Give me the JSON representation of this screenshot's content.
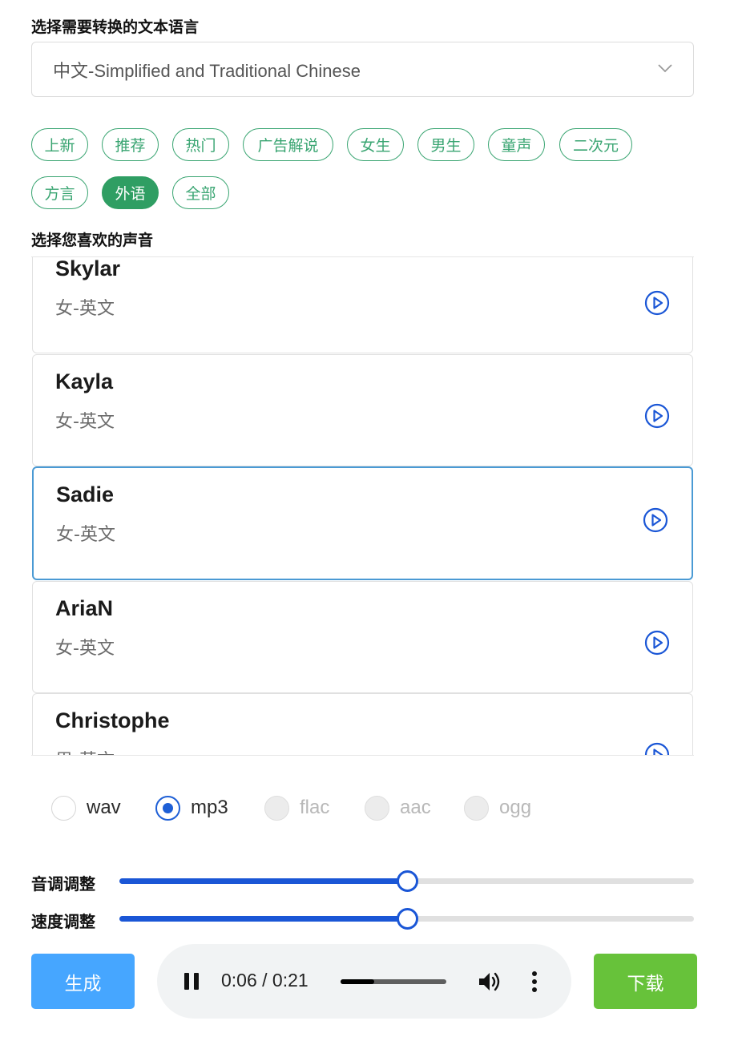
{
  "language_section": {
    "label": "选择需要转换的文本语言",
    "selected_value": "中文-Simplified and Traditional Chinese"
  },
  "category_tags": [
    {
      "label": "上新",
      "active": false
    },
    {
      "label": "推荐",
      "active": false
    },
    {
      "label": "热门",
      "active": false
    },
    {
      "label": "广告解说",
      "active": false
    },
    {
      "label": "女生",
      "active": false
    },
    {
      "label": "男生",
      "active": false
    },
    {
      "label": "童声",
      "active": false
    },
    {
      "label": "二次元",
      "active": false
    },
    {
      "label": "方言",
      "active": false
    },
    {
      "label": "外语",
      "active": true
    },
    {
      "label": "全部",
      "active": false
    }
  ],
  "voice_section": {
    "label": "选择您喜欢的声音",
    "voices": [
      {
        "name": "Skylar",
        "desc": "女-英文",
        "selected": false
      },
      {
        "name": "Kayla",
        "desc": "女-英文",
        "selected": false
      },
      {
        "name": "Sadie",
        "desc": "女-英文",
        "selected": true
      },
      {
        "name": "AriaN",
        "desc": "女-英文",
        "selected": false
      },
      {
        "name": "Christophe",
        "desc": "男-英文",
        "selected": false
      }
    ]
  },
  "formats": [
    {
      "label": "wav",
      "checked": false,
      "disabled": false
    },
    {
      "label": "mp3",
      "checked": true,
      "disabled": false
    },
    {
      "label": "flac",
      "checked": false,
      "disabled": true
    },
    {
      "label": "aac",
      "checked": false,
      "disabled": true
    },
    {
      "label": "ogg",
      "checked": false,
      "disabled": true
    }
  ],
  "sliders": [
    {
      "label": "音调调整",
      "value_fraction": 0.5
    },
    {
      "label": "速度调整",
      "value_fraction": 0.5
    }
  ],
  "actions": {
    "generate_label": "生成",
    "download_label": "下载"
  },
  "player": {
    "current_time": "0:06",
    "duration": "0:21",
    "time_text": "0:06 / 0:21",
    "progress_fraction": 0.32,
    "state": "playing"
  },
  "colors": {
    "tag_green": "#3aa572",
    "tag_active_bg": "#2f9e63",
    "accent_blue": "#1a56d6",
    "selected_card_border": "#4a9ad4",
    "generate_bg": "#46a6ff",
    "download_bg": "#67c23a"
  },
  "icons": {
    "select_chevron": "chevron-down-icon",
    "voice_play": "play-circle-icon",
    "player_pause": "pause-icon",
    "player_volume": "volume-icon",
    "player_more": "more-vertical-icon"
  }
}
